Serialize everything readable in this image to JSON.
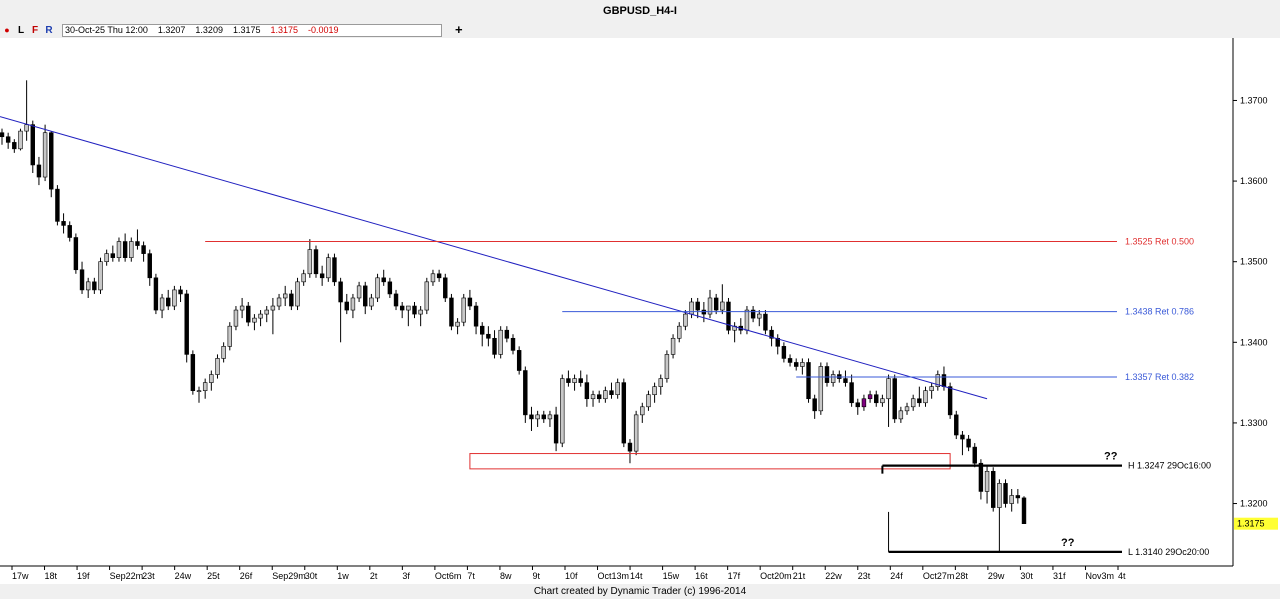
{
  "window": {
    "title": "GBPUSD_H4-I"
  },
  "toolbar": {
    "dot_label": "●",
    "l_label": "L",
    "f_label": "F",
    "r_label": "R",
    "datetime": "30-Oct-25 Thu 12:00",
    "open": "1.3207",
    "high": "1.3209",
    "low": "1.3175",
    "close": "1.3175",
    "change": "-0.0019",
    "crosshair_icon": "+"
  },
  "footer": {
    "credit": "Chart created by Dynamic Trader  (c) 1996-2014"
  },
  "colors": {
    "up_candle": "#c8c8c8",
    "down_candle": "#000000",
    "trendline": "#2020c0",
    "red_level": "#e03030",
    "blue_level": "#3a5ad8",
    "price_tag": "#ffff33",
    "purple_candle": "#800080"
  },
  "chart_data": {
    "type": "candlestick",
    "ylim": [
      1.3125,
      1.3775
    ],
    "y_ticks": [
      1.37,
      1.36,
      1.35,
      1.34,
      1.33,
      1.32
    ],
    "y_tick_labels": [
      "1.3700",
      "1.3600",
      "1.3500",
      "1.3400",
      "1.3300",
      "1.3200"
    ],
    "x_tick_labels": [
      "17w",
      "18t",
      "19f",
      "Sep22m",
      "23t",
      "24w",
      "25t",
      "26f",
      "Sep29m",
      "30t",
      "1w",
      "2t",
      "3f",
      "Oct6m",
      "7t",
      "8w",
      "9t",
      "10f",
      "Oct13m",
      "14t",
      "15w",
      "16t",
      "17f",
      "Oct20m",
      "21t",
      "22w",
      "23t",
      "24f",
      "Oct27m",
      "28t",
      "29w",
      "30t",
      "31f",
      "Nov3m",
      "4t"
    ],
    "last_price": "1.3175",
    "candles": [
      [
        1.366,
        1.3665,
        1.3645,
        1.3655
      ],
      [
        1.3655,
        1.366,
        1.364,
        1.3648
      ],
      [
        1.3648,
        1.3652,
        1.3635,
        1.364
      ],
      [
        1.364,
        1.3665,
        1.3638,
        1.3662
      ],
      [
        1.3662,
        1.3725,
        1.365,
        1.367
      ],
      [
        1.367,
        1.3675,
        1.361,
        1.362
      ],
      [
        1.362,
        1.363,
        1.3595,
        1.3605
      ],
      [
        1.3605,
        1.367,
        1.36,
        1.366
      ],
      [
        1.366,
        1.3662,
        1.358,
        1.359
      ],
      [
        1.359,
        1.3595,
        1.3545,
        1.355
      ],
      [
        1.355,
        1.356,
        1.3535,
        1.3545
      ],
      [
        1.3545,
        1.355,
        1.3525,
        1.353
      ],
      [
        1.353,
        1.3535,
        1.3485,
        1.349
      ],
      [
        1.349,
        1.35,
        1.346,
        1.3465
      ],
      [
        1.3465,
        1.348,
        1.3455,
        1.3475
      ],
      [
        1.3475,
        1.348,
        1.346,
        1.3465
      ],
      [
        1.3465,
        1.3505,
        1.346,
        1.35
      ],
      [
        1.35,
        1.3515,
        1.3495,
        1.351
      ],
      [
        1.351,
        1.352,
        1.35,
        1.3505
      ],
      [
        1.3505,
        1.353,
        1.35,
        1.3525
      ],
      [
        1.3525,
        1.3535,
        1.35,
        1.3505
      ],
      [
        1.3505,
        1.353,
        1.35,
        1.3525
      ],
      [
        1.3525,
        1.354,
        1.3515,
        1.352
      ],
      [
        1.352,
        1.3525,
        1.35,
        1.351
      ],
      [
        1.351,
        1.3515,
        1.347,
        1.348
      ],
      [
        1.348,
        1.3485,
        1.3435,
        1.344
      ],
      [
        1.344,
        1.346,
        1.343,
        1.3455
      ],
      [
        1.3455,
        1.3465,
        1.344,
        1.3445
      ],
      [
        1.3445,
        1.347,
        1.344,
        1.3465
      ],
      [
        1.3465,
        1.347,
        1.345,
        1.346
      ],
      [
        1.346,
        1.3465,
        1.3375,
        1.3385
      ],
      [
        1.3385,
        1.339,
        1.3335,
        1.334
      ],
      [
        1.334,
        1.3345,
        1.3325,
        1.334
      ],
      [
        1.334,
        1.3355,
        1.333,
        1.335
      ],
      [
        1.335,
        1.3365,
        1.334,
        1.336
      ],
      [
        1.336,
        1.3385,
        1.3355,
        1.338
      ],
      [
        1.338,
        1.34,
        1.3375,
        1.3395
      ],
      [
        1.3395,
        1.3425,
        1.339,
        1.342
      ],
      [
        1.342,
        1.3445,
        1.3415,
        1.344
      ],
      [
        1.344,
        1.3455,
        1.343,
        1.3445
      ],
      [
        1.3445,
        1.345,
        1.342,
        1.3425
      ],
      [
        1.3425,
        1.3435,
        1.3415,
        1.343
      ],
      [
        1.343,
        1.344,
        1.342,
        1.3435
      ],
      [
        1.3435,
        1.3445,
        1.3425,
        1.344
      ],
      [
        1.344,
        1.3455,
        1.341,
        1.3445
      ],
      [
        1.3445,
        1.346,
        1.344,
        1.3455
      ],
      [
        1.3455,
        1.347,
        1.3445,
        1.346
      ],
      [
        1.346,
        1.3465,
        1.344,
        1.3445
      ],
      [
        1.3445,
        1.348,
        1.344,
        1.3475
      ],
      [
        1.3475,
        1.349,
        1.347,
        1.3485
      ],
      [
        1.3485,
        1.3528,
        1.348,
        1.3515
      ],
      [
        1.3515,
        1.352,
        1.348,
        1.3485
      ],
      [
        1.3485,
        1.3495,
        1.347,
        1.348
      ],
      [
        1.348,
        1.351,
        1.3475,
        1.3505
      ],
      [
        1.3505,
        1.351,
        1.347,
        1.3475
      ],
      [
        1.3475,
        1.348,
        1.34,
        1.345
      ],
      [
        1.345,
        1.346,
        1.3435,
        1.344
      ],
      [
        1.344,
        1.346,
        1.343,
        1.3455
      ],
      [
        1.3455,
        1.3475,
        1.345,
        1.347
      ],
      [
        1.347,
        1.3475,
        1.3435,
        1.3445
      ],
      [
        1.3445,
        1.346,
        1.344,
        1.3455
      ],
      [
        1.3455,
        1.3485,
        1.345,
        1.348
      ],
      [
        1.348,
        1.349,
        1.347,
        1.3475
      ],
      [
        1.3475,
        1.348,
        1.3455,
        1.346
      ],
      [
        1.346,
        1.3465,
        1.344,
        1.3445
      ],
      [
        1.3445,
        1.345,
        1.343,
        1.344
      ],
      [
        1.344,
        1.3445,
        1.342,
        1.3445
      ],
      [
        1.3445,
        1.345,
        1.343,
        1.3435
      ],
      [
        1.3435,
        1.3445,
        1.342,
        1.344
      ],
      [
        1.344,
        1.348,
        1.3435,
        1.3475
      ],
      [
        1.3475,
        1.349,
        1.347,
        1.3485
      ],
      [
        1.3485,
        1.349,
        1.3475,
        1.348
      ],
      [
        1.348,
        1.3485,
        1.345,
        1.3455
      ],
      [
        1.3455,
        1.346,
        1.3415,
        1.342
      ],
      [
        1.342,
        1.343,
        1.341,
        1.3425
      ],
      [
        1.3425,
        1.346,
        1.342,
        1.3455
      ],
      [
        1.3455,
        1.3465,
        1.344,
        1.3445
      ],
      [
        1.3445,
        1.345,
        1.341,
        1.342
      ],
      [
        1.342,
        1.3425,
        1.3395,
        1.341
      ],
      [
        1.341,
        1.342,
        1.3395,
        1.3405
      ],
      [
        1.3405,
        1.3415,
        1.338,
        1.3385
      ],
      [
        1.3385,
        1.342,
        1.338,
        1.3415
      ],
      [
        1.3415,
        1.342,
        1.34,
        1.3405
      ],
      [
        1.3405,
        1.341,
        1.3385,
        1.339
      ],
      [
        1.339,
        1.3395,
        1.336,
        1.3365
      ],
      [
        1.3365,
        1.337,
        1.33,
        1.331
      ],
      [
        1.331,
        1.332,
        1.329,
        1.3305
      ],
      [
        1.3305,
        1.3315,
        1.3295,
        1.331
      ],
      [
        1.331,
        1.3315,
        1.33,
        1.3305
      ],
      [
        1.3305,
        1.3315,
        1.3295,
        1.331
      ],
      [
        1.331,
        1.332,
        1.3265,
        1.3275
      ],
      [
        1.3275,
        1.336,
        1.327,
        1.3355
      ],
      [
        1.3355,
        1.3365,
        1.3345,
        1.335
      ],
      [
        1.335,
        1.336,
        1.334,
        1.3355
      ],
      [
        1.3355,
        1.3365,
        1.3345,
        1.335
      ],
      [
        1.335,
        1.336,
        1.332,
        1.333
      ],
      [
        1.333,
        1.334,
        1.332,
        1.3335
      ],
      [
        1.3335,
        1.334,
        1.3325,
        1.333
      ],
      [
        1.333,
        1.3345,
        1.3325,
        1.334
      ],
      [
        1.334,
        1.335,
        1.333,
        1.3335
      ],
      [
        1.3335,
        1.3355,
        1.333,
        1.335
      ],
      [
        1.335,
        1.3355,
        1.327,
        1.3275
      ],
      [
        1.3275,
        1.328,
        1.325,
        1.3265
      ],
      [
        1.3265,
        1.3315,
        1.326,
        1.331
      ],
      [
        1.331,
        1.3325,
        1.33,
        1.332
      ],
      [
        1.332,
        1.334,
        1.3315,
        1.3335
      ],
      [
        1.3335,
        1.335,
        1.3325,
        1.3345
      ],
      [
        1.3345,
        1.336,
        1.3335,
        1.3355
      ],
      [
        1.3355,
        1.339,
        1.335,
        1.3385
      ],
      [
        1.3385,
        1.341,
        1.338,
        1.3405
      ],
      [
        1.3405,
        1.3425,
        1.34,
        1.342
      ],
      [
        1.342,
        1.344,
        1.3415,
        1.3435
      ],
      [
        1.3435,
        1.3455,
        1.343,
        1.345
      ],
      [
        1.345,
        1.3455,
        1.343,
        1.344
      ],
      [
        1.344,
        1.345,
        1.3425,
        1.3435
      ],
      [
        1.3435,
        1.3465,
        1.343,
        1.3455
      ],
      [
        1.3455,
        1.346,
        1.3435,
        1.344
      ],
      [
        1.344,
        1.3472,
        1.3435,
        1.345
      ],
      [
        1.345,
        1.3455,
        1.341,
        1.3415
      ],
      [
        1.3415,
        1.3425,
        1.34,
        1.342
      ],
      [
        1.342,
        1.343,
        1.341,
        1.3415
      ],
      [
        1.3415,
        1.3445,
        1.341,
        1.344
      ],
      [
        1.344,
        1.3445,
        1.3425,
        1.343
      ],
      [
        1.343,
        1.344,
        1.342,
        1.3435
      ],
      [
        1.3435,
        1.344,
        1.341,
        1.3415
      ],
      [
        1.3415,
        1.342,
        1.3395,
        1.3405
      ],
      [
        1.3405,
        1.341,
        1.3385,
        1.3395
      ],
      [
        1.3395,
        1.34,
        1.3375,
        1.338
      ],
      [
        1.338,
        1.3385,
        1.337,
        1.3375
      ],
      [
        1.3375,
        1.338,
        1.3365,
        1.337
      ],
      [
        1.337,
        1.338,
        1.336,
        1.3375
      ],
      [
        1.3375,
        1.338,
        1.3325,
        1.333
      ],
      [
        1.333,
        1.3335,
        1.3305,
        1.3315
      ],
      [
        1.3315,
        1.3375,
        1.331,
        1.337
      ],
      [
        1.337,
        1.3375,
        1.3345,
        1.335
      ],
      [
        1.335,
        1.3365,
        1.3345,
        1.336
      ],
      [
        1.336,
        1.3365,
        1.335,
        1.3355
      ],
      [
        1.3355,
        1.3365,
        1.3345,
        1.335
      ],
      [
        1.335,
        1.336,
        1.332,
        1.3325
      ],
      [
        1.3325,
        1.333,
        1.331,
        1.332
      ],
      [
        1.332,
        1.3335,
        1.3315,
        1.333
      ],
      [
        1.333,
        1.334,
        1.3325,
        1.3335
      ],
      [
        1.3335,
        1.334,
        1.332,
        1.3325
      ],
      [
        1.3325,
        1.3335,
        1.332,
        1.333
      ],
      [
        1.333,
        1.336,
        1.3295,
        1.3355
      ],
      [
        1.3355,
        1.336,
        1.33,
        1.3305
      ],
      [
        1.3305,
        1.332,
        1.33,
        1.3315
      ],
      [
        1.3315,
        1.3325,
        1.331,
        1.332
      ],
      [
        1.332,
        1.3335,
        1.3315,
        1.333
      ],
      [
        1.333,
        1.3345,
        1.332,
        1.3325
      ],
      [
        1.3325,
        1.3345,
        1.332,
        1.334
      ],
      [
        1.334,
        1.335,
        1.333,
        1.3345
      ],
      [
        1.3345,
        1.3365,
        1.334,
        1.336
      ],
      [
        1.336,
        1.337,
        1.334,
        1.3345
      ],
      [
        1.3345,
        1.335,
        1.3305,
        1.331
      ],
      [
        1.331,
        1.3315,
        1.328,
        1.3285
      ],
      [
        1.3285,
        1.329,
        1.326,
        1.328
      ],
      [
        1.328,
        1.3285,
        1.3265,
        1.327
      ],
      [
        1.327,
        1.3275,
        1.3245,
        1.325
      ],
      [
        1.325,
        1.3255,
        1.3205,
        1.3215
      ],
      [
        1.3215,
        1.3247,
        1.32,
        1.324
      ],
      [
        1.324,
        1.3245,
        1.319,
        1.3195
      ],
      [
        1.3195,
        1.323,
        1.314,
        1.3225
      ],
      [
        1.3225,
        1.323,
        1.3195,
        1.32
      ],
      [
        1.32,
        1.3218,
        1.319,
        1.321
      ],
      [
        1.321,
        1.3218,
        1.32,
        1.3207
      ],
      [
        1.3207,
        1.3209,
        1.3175,
        1.3175
      ]
    ],
    "trendline": {
      "from": {
        "bar": 0,
        "price": 1.368
      },
      "to": {
        "bar": 160,
        "price": 1.333
      }
    },
    "levels": [
      {
        "price": 1.3525,
        "label": "1.3525 Ret 0.500",
        "color": "red",
        "from_bar": 33
      },
      {
        "price": 1.3438,
        "label": "1.3438 Ret 0.786",
        "color": "blue",
        "from_bar": 91
      },
      {
        "price": 1.3357,
        "label": "1.3357 Ret 0.382",
        "color": "blue",
        "from_bar": 129
      },
      {
        "price": 1.3247,
        "label": "H 1.3247 29Oc16:00",
        "color": "black",
        "from_bar": 143
      },
      {
        "price": 1.314,
        "label": "L 1.3140 29Oc20:00",
        "color": "black",
        "from_bar": 144
      }
    ],
    "support_zone": {
      "top": 1.3262,
      "bottom": 1.3243,
      "from_bar": 76,
      "to_bar": 154
    },
    "annotations": [
      {
        "text": "??",
        "near_price": 1.3247
      },
      {
        "text": "??",
        "near_price": 1.314
      }
    ]
  }
}
